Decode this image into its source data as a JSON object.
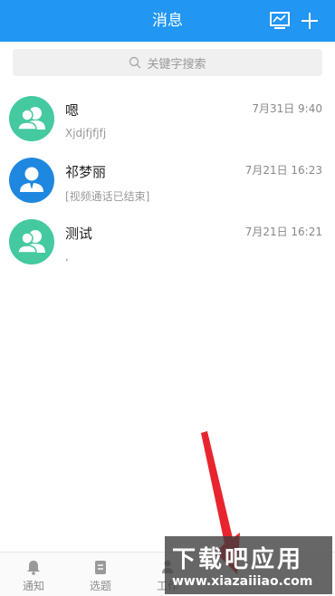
{
  "header": {
    "title": "消息"
  },
  "search": {
    "placeholder": "关键字搜索"
  },
  "conversations": [
    {
      "name": "嗯",
      "time": "7月31日 9:40",
      "preview": "Xjdjfjfjfj",
      "avatar": "group-avatar"
    },
    {
      "name": "祁梦丽",
      "time": "7月21日 16:23",
      "preview": "[视频通话已结束]",
      "avatar": "person-avatar"
    },
    {
      "name": "测试",
      "time": "7月21日 16:21",
      "preview": ",",
      "avatar": "group-avatar"
    }
  ],
  "tabbar": {
    "items": [
      {
        "label": "通知",
        "icon": "bell-icon"
      },
      {
        "label": "选题",
        "icon": "document-icon"
      },
      {
        "label": "工作",
        "icon": "people-icon"
      }
    ]
  },
  "watermark": {
    "line1": "下载吧应用",
    "line2": "www.xiazaiiiao.com"
  },
  "colors": {
    "primary": "#2196f3",
    "group_avatar": "#44c9a0",
    "person_avatar": "#1e87e0",
    "arrow": "#e8252e"
  }
}
